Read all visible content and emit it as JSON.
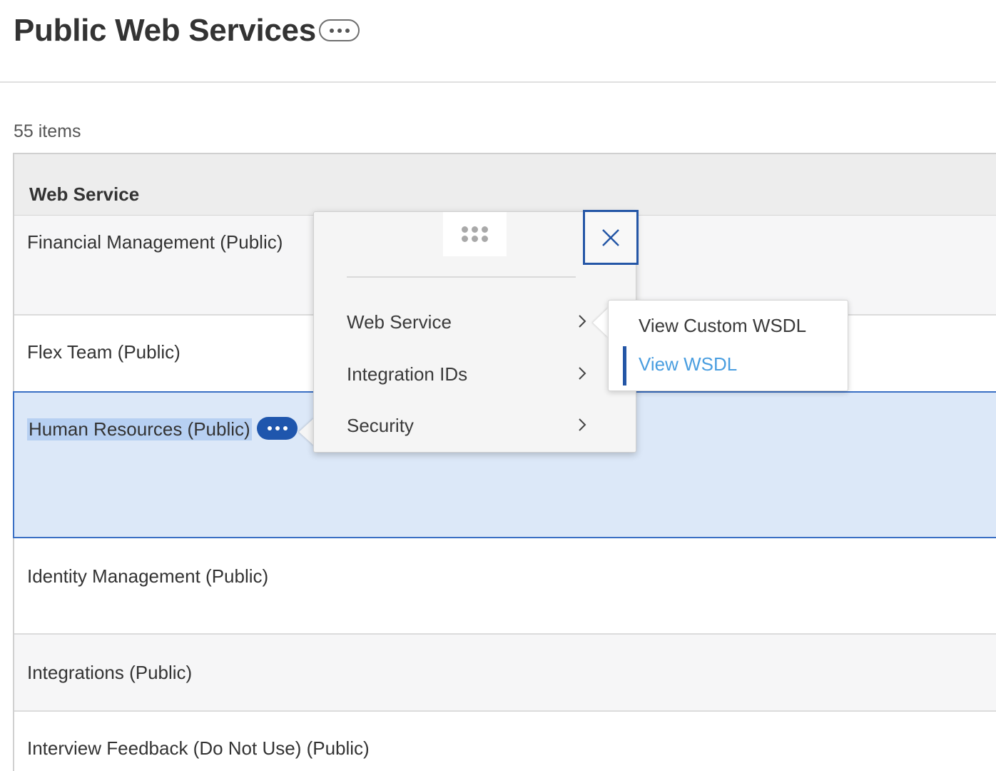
{
  "page": {
    "title": "Public Web Services",
    "item_count": "55 items"
  },
  "grid": {
    "column_header": "Web Service",
    "rows": [
      {
        "label": "Financial Management (Public)"
      },
      {
        "label": "Flex Team (Public)"
      },
      {
        "label": "Human Resources (Public)",
        "selected": true
      },
      {
        "label": "Identity Management (Public)"
      },
      {
        "label": "Integrations (Public)"
      },
      {
        "label": "Interview Feedback (Do Not Use) (Public)"
      }
    ]
  },
  "popup": {
    "menu": [
      {
        "label": "Web Service"
      },
      {
        "label": "Integration IDs"
      },
      {
        "label": "Security"
      }
    ],
    "submenu": [
      {
        "label": "View Custom WSDL"
      },
      {
        "label": "View WSDL",
        "active": true
      }
    ]
  },
  "colors": {
    "accent": "#2456a6",
    "selected_row": "#dce8f8",
    "link_active": "#4a9ee0"
  }
}
